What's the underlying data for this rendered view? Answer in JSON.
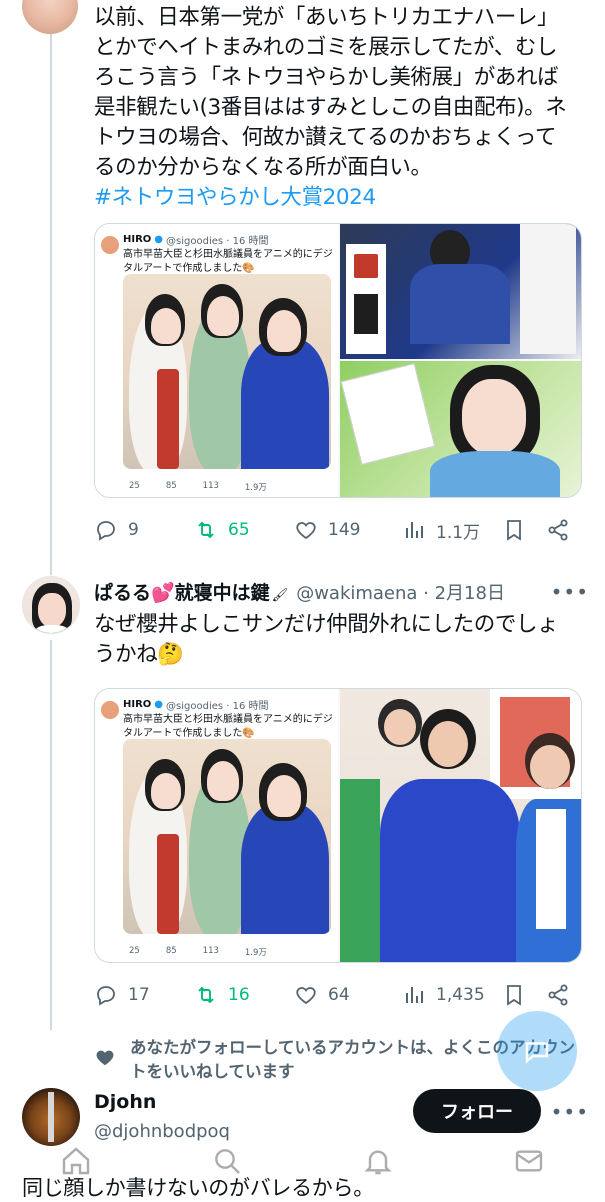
{
  "tweet1": {
    "lines": [
      "以前、日本第一党が「あいちトリカエナハーレ」",
      "とかでヘイトまみれのゴミを展示してたが、むし",
      "ろこう言う「ネトウヨやらかし美術展」があれば",
      "是非観たい(3番目ははすみとしこの自由配布)。ネ",
      "トウヨの場合、何故か讃えてるのかおちょくって",
      "るのか分からなくなる所が面白い。"
    ],
    "hashtag": "#ネトウヨやらかし大賞2024",
    "embed": {
      "name": "HIRO",
      "handle": "@sigoodies · 16 時間",
      "text": "高市早苗大臣と杉田水脈議員をアニメ的にデジタルアートで作成しました🎨",
      "stats": [
        "25",
        "85",
        "113",
        "1.9万"
      ]
    },
    "actions": {
      "reply": "9",
      "retweet": "65",
      "like": "149",
      "views": "1.1万"
    }
  },
  "tweet2": {
    "name": "ぱるる💕就寝中は鍵",
    "handle": "@wakimaena · 2月18日",
    "lines": [
      "なぜ櫻井よしこサンだけ仲間外れにしたのでしょ",
      "うかね🤔"
    ],
    "embed": {
      "name": "HIRO",
      "handle": "@sigoodies · 16 時間",
      "text": "高市早苗大臣と杉田水脈議員をアニメ的にデジタルアートで作成しました🎨",
      "stats": [
        "25",
        "85",
        "113",
        "1.9万"
      ]
    },
    "actions": {
      "reply": "17",
      "retweet": "16",
      "like": "64",
      "views": "1,435"
    }
  },
  "liked_note": "あなたがフォローしているアカウントは、よくこのアカウントをいいねしています",
  "tweet3": {
    "name": "Djohn",
    "handle": "@djohnbodpoq",
    "follow": "フォロー",
    "text": "同じ顔しか書けないのがバレるから。"
  },
  "colors": {
    "accent": "#1d9bf0",
    "retweet": "#00ba7c",
    "muted": "#536471"
  }
}
